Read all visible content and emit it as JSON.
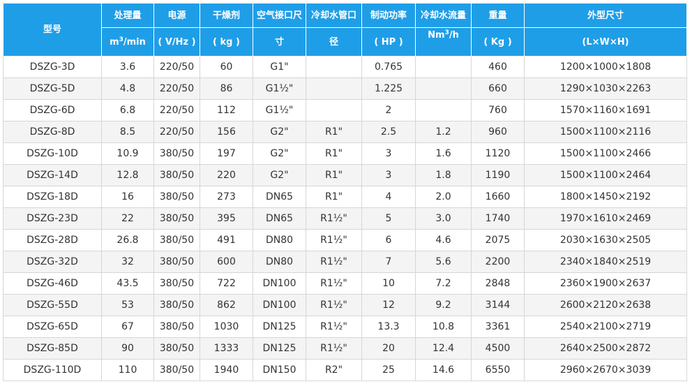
{
  "header": {
    "model": "型号",
    "capacity": {
      "top": "处理量",
      "bottom_pre": "m",
      "bottom_sup": "3",
      "bottom_post": "/min"
    },
    "power": {
      "top": "电源",
      "bottom": "( V/Hz )"
    },
    "desiccant": {
      "top": "干燥剂",
      "bottom": "( kg )"
    },
    "air_port": {
      "top": "空气接口尺",
      "bottom": "寸"
    },
    "water_pipe": {
      "top": "冷却水管口",
      "bottom": "径"
    },
    "brake_power": {
      "top": "制动功率",
      "bottom": "( HP )"
    },
    "water_flow": {
      "top": "冷却水流量",
      "bottom_pre": "Nm",
      "bottom_sup": "3",
      "bottom_post": "/h"
    },
    "weight": {
      "top": "重量",
      "bottom": "( Kg )"
    },
    "dimensions": {
      "top": "外型尺寸",
      "bottom": "(L×W×H)"
    }
  },
  "rows": [
    [
      "DSZG-3D",
      "3.6",
      "220/50",
      "60",
      "G1\"",
      "",
      "0.765",
      "",
      "460",
      "1200×1000×1808"
    ],
    [
      "DSZG-5D",
      "4.8",
      "220/50",
      "86",
      "G1½\"",
      "",
      "1.225",
      "",
      "660",
      "1290×1030×2263"
    ],
    [
      "DSZG-6D",
      "6.8",
      "220/50",
      "112",
      "G1½\"",
      "",
      "2",
      "",
      "760",
      "1570×1160×1691"
    ],
    [
      "DSZG-8D",
      "8.5",
      "220/50",
      "156",
      "G2\"",
      "R1\"",
      "2.5",
      "1.2",
      "960",
      "1500×1100×2116"
    ],
    [
      "DSZG-10D",
      "10.9",
      "380/50",
      "197",
      "G2\"",
      "R1\"",
      "3",
      "1.6",
      "1120",
      "1500×1100×2466"
    ],
    [
      "DSZG-14D",
      "12.8",
      "380/50",
      "220",
      "G2\"",
      "R1\"",
      "3",
      "1.8",
      "1190",
      "1500×1100×2464"
    ],
    [
      "DSZG-18D",
      "16",
      "380/50",
      "273",
      "DN65",
      "R1\"",
      "4",
      "2.0",
      "1660",
      "1800×1450×2192"
    ],
    [
      "DSZG-23D",
      "22",
      "380/50",
      "395",
      "DN65",
      "R1½\"",
      "5",
      "3.0",
      "1740",
      "1970×1610×2469"
    ],
    [
      "DSZG-28D",
      "26.8",
      "380/50",
      "491",
      "DN80",
      "R1½\"",
      "6",
      "4.6",
      "2075",
      "2030×1630×2505"
    ],
    [
      "DSZG-32D",
      "32",
      "380/50",
      "600",
      "DN80",
      "R1½\"",
      "7",
      "5.6",
      "2200",
      "2340×1840×2519"
    ],
    [
      "DSZG-46D",
      "43.5",
      "380/50",
      "722",
      "DN100",
      "R1½\"",
      "10",
      "7.2",
      "2848",
      "2360×1900×2637"
    ],
    [
      "DSZG-55D",
      "53",
      "380/50",
      "862",
      "DN100",
      "R1½\"",
      "12",
      "9.2",
      "3144",
      "2600×2120×2638"
    ],
    [
      "DSZG-65D",
      "67",
      "380/50",
      "1030",
      "DN125",
      "R1½\"",
      "13.3",
      "10.8",
      "3361",
      "2540×2100×2719"
    ],
    [
      "DSZG-85D",
      "90",
      "380/50",
      "1333",
      "DN125",
      "R1½\"",
      "20",
      "12.4",
      "4500",
      "2640×2500×2872"
    ],
    [
      "DSZG-110D",
      "110",
      "380/50",
      "1940",
      "DN150",
      "R2\"",
      "25",
      "14.6",
      "6550",
      "2960×2670×3039"
    ]
  ]
}
